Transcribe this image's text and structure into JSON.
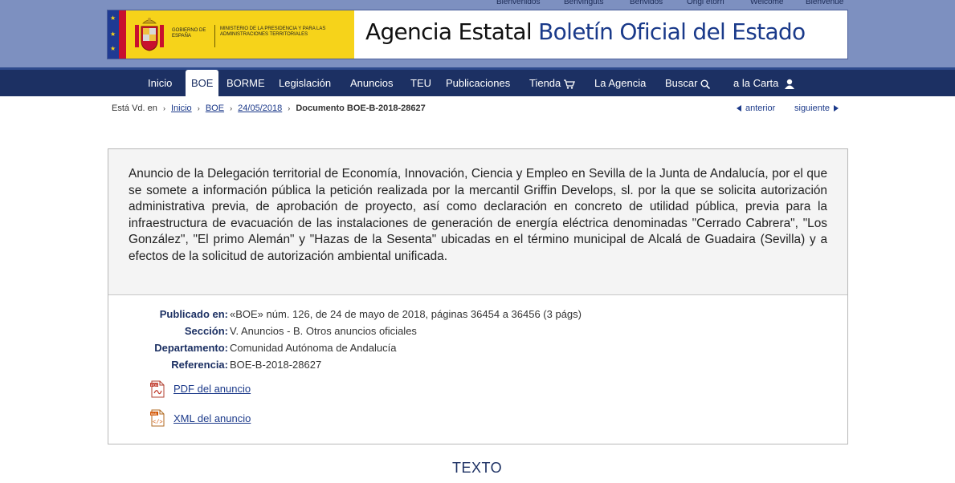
{
  "lang_bar": [
    "Bienvenidos",
    "Benvinguts",
    "Benvidos",
    "Ongi etorri",
    "Welcome",
    "Bienvenue"
  ],
  "header": {
    "gov_text": "GOBIERNO DE ESPAÑA",
    "ministry_text": "MINISTERIO DE LA PRESIDENCIA Y PARA LAS ADMINISTRACIONES TERRITORIALES",
    "title_plain": "Agencia Estatal",
    "title_blue": "Boletín Oficial del Estado"
  },
  "nav": {
    "items": [
      "Inicio",
      "BOE",
      "BORME",
      "Legislación",
      "Anuncios",
      "TEU",
      "Publicaciones",
      "Tienda",
      "La Agencia",
      "Buscar",
      "a la Carta"
    ],
    "active": "BOE"
  },
  "breadcrumb": {
    "prefix": "Está Vd. en",
    "links": [
      "Inicio",
      "BOE",
      "24/05/2018"
    ],
    "current": "Documento BOE-B-2018-28627"
  },
  "pager": {
    "prev": "anterior",
    "next": "siguiente"
  },
  "document": {
    "title": "Anuncio de la Delegación territorial de Economía, Innovación, Ciencia y Empleo en Sevilla de la Junta de Andalucía, por el que se somete a información pública la petición realizada por la mercantil Griffin Develops, sl. por la que se solicita autorización administrativa previa, de aprobación de proyecto, así como declaración en concreto de utilidad pública, previa para la infraestructura de evacuación de las instalaciones de generación de energía eléctrica denominadas \"Cerrado Cabrera\", \"Los González\", \"El primo Alemán\" y \"Hazas de la Sesenta\" ubicadas en el término municipal de Alcalá de Guadaira (Sevilla) y a efectos de la solicitud de autorización ambiental unificada.",
    "meta": [
      {
        "label": "Publicado en:",
        "value": "«BOE» núm. 126, de 24 de mayo de 2018, páginas 36454 a 36456 (3 págs)"
      },
      {
        "label": "Sección:",
        "value": "V. Anuncios - B. Otros anuncios oficiales"
      },
      {
        "label": "Departamento:",
        "value": "Comunidad Autónoma de Andalucía"
      },
      {
        "label": "Referencia:",
        "value": "BOE-B-2018-28627"
      }
    ],
    "downloads": [
      {
        "label": "PDF del anuncio",
        "icon": "pdf-icon"
      },
      {
        "label": "XML del anuncio",
        "icon": "xml-icon"
      }
    ]
  },
  "section_heading": "TEXTO",
  "colors": {
    "nav_bg": "#1c3063",
    "top_band": "#7d90c0",
    "link": "#1c3a8a",
    "label": "#1c3063"
  }
}
